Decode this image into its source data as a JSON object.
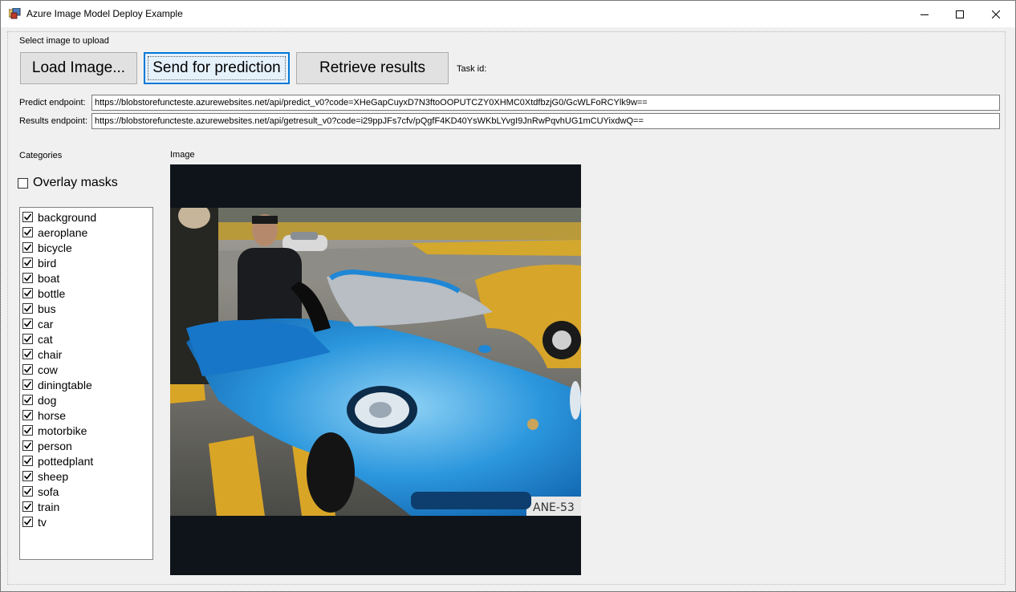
{
  "window": {
    "title": "Azure Image Model Deploy Example"
  },
  "upload": {
    "label": "Select image to upload",
    "load_button": "Load Image...",
    "send_button": "Send for prediction",
    "retrieve_button": "Retrieve results",
    "task_id_label": "Task id:"
  },
  "endpoints": {
    "predict_label": "Predict endpoint:",
    "predict_value": "https://blobstorefuncteste.azurewebsites.net/api/predict_v0?code=XHeGapCuyxD7N3ftoOOPUTCZY0XHMC0XtdfbzjG0/GcWLFoRCYlk9w==",
    "results_label": "Results endpoint:",
    "results_value": "https://blobstorefuncteste.azurewebsites.net/api/getresult_v0?code=i29ppJFs7cfv/pQgfF4KD40YsWKbLYvgI9JnRwPqvhUG1mCUYixdwQ=="
  },
  "categories": {
    "label": "Categories",
    "overlay_masks_label": "Overlay masks",
    "overlay_masks_checked": false,
    "items": [
      {
        "label": "background",
        "checked": true
      },
      {
        "label": "aeroplane",
        "checked": true
      },
      {
        "label": "bicycle",
        "checked": true
      },
      {
        "label": "bird",
        "checked": true
      },
      {
        "label": "boat",
        "checked": true
      },
      {
        "label": "bottle",
        "checked": true
      },
      {
        "label": "bus",
        "checked": true
      },
      {
        "label": "car",
        "checked": true
      },
      {
        "label": "cat",
        "checked": true
      },
      {
        "label": "chair",
        "checked": true
      },
      {
        "label": "cow",
        "checked": true
      },
      {
        "label": "diningtable",
        "checked": true
      },
      {
        "label": "dog",
        "checked": true
      },
      {
        "label": "horse",
        "checked": true
      },
      {
        "label": "motorbike",
        "checked": true
      },
      {
        "label": "person",
        "checked": true
      },
      {
        "label": "pottedplant",
        "checked": true
      },
      {
        "label": "sheep",
        "checked": true
      },
      {
        "label": "sofa",
        "checked": true
      },
      {
        "label": "train",
        "checked": true
      },
      {
        "label": "tv",
        "checked": true
      }
    ]
  },
  "image": {
    "label": "Image"
  },
  "colors": {
    "focus_border": "#0078d7",
    "car_blue": "#1f87d6",
    "yellow_stripe": "#d9a526"
  }
}
